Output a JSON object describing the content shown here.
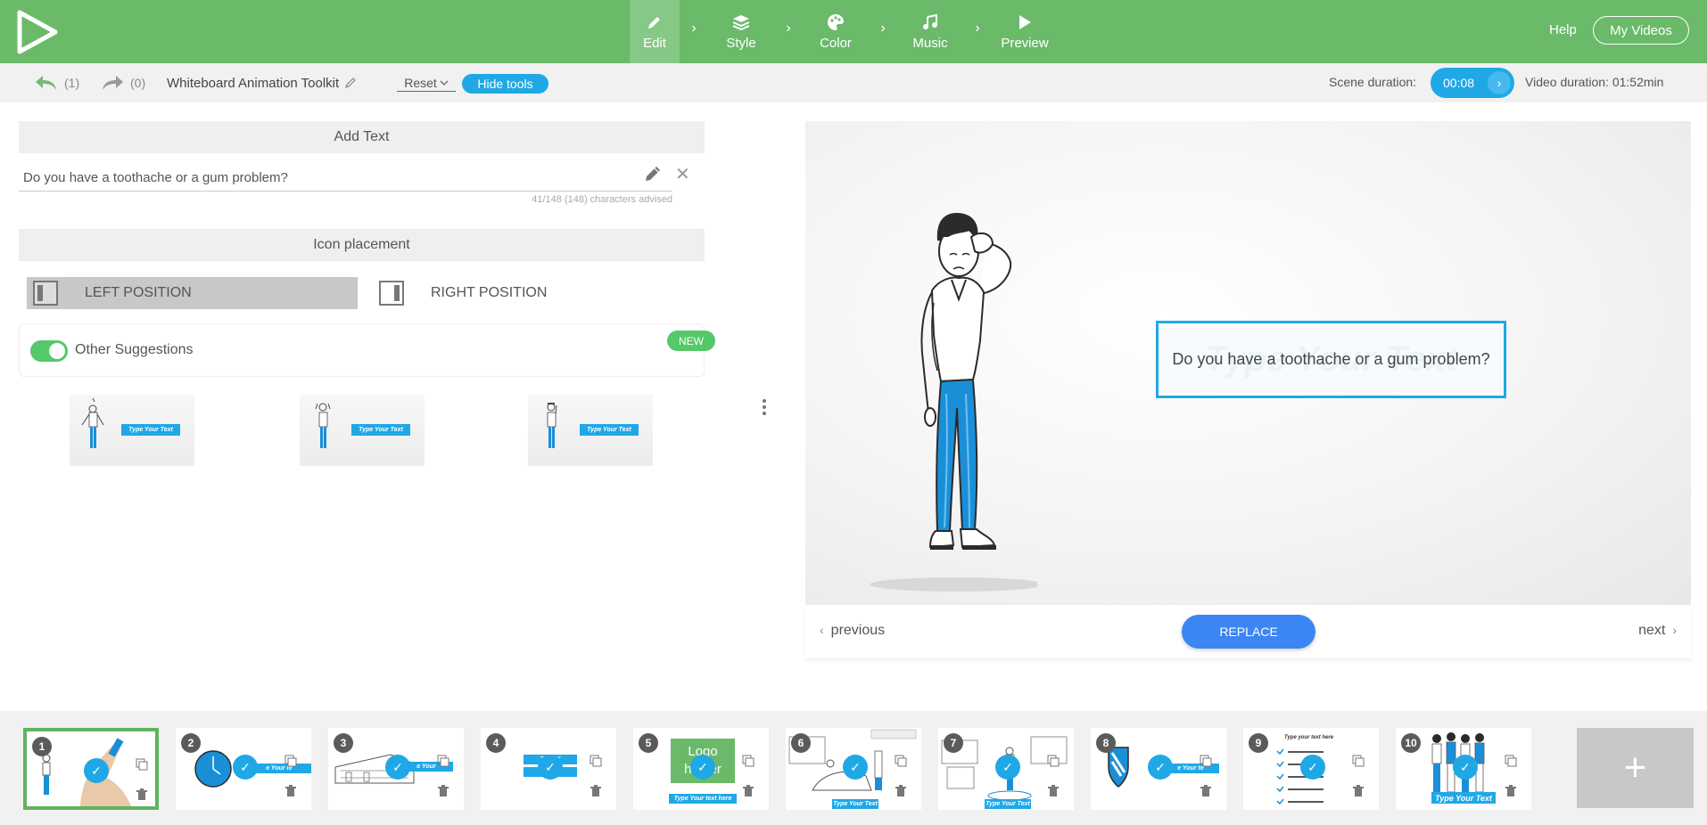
{
  "topbar": {
    "steps": [
      {
        "label": "Edit",
        "icon": "pencil-icon"
      },
      {
        "label": "Style",
        "icon": "layers-icon"
      },
      {
        "label": "Color",
        "icon": "palette-icon"
      },
      {
        "label": "Music",
        "icon": "music-icon"
      },
      {
        "label": "Preview",
        "icon": "play-icon"
      }
    ],
    "active_step": "Edit",
    "help": "Help",
    "my_videos": "My Videos"
  },
  "toolbar": {
    "undo_count": "(1)",
    "redo_count": "(0)",
    "project_title": "Whiteboard Animation Toolkit",
    "reset": "Reset",
    "hide_tools": "Hide tools",
    "scene_duration_label": "Scene duration:",
    "scene_duration": "00:08",
    "video_duration": "Video duration: 01:52min"
  },
  "left": {
    "add_text_title": "Add Text",
    "text_value": "Do you have a toothache or a gum problem?",
    "char_count": "41/148 (148) characters advised",
    "icon_placement_title": "Icon placement",
    "left_position": "LEFT POSITION",
    "right_position": "RIGHT POSITION",
    "other_suggestions": "Other Suggestions",
    "new_badge": "NEW",
    "suggestion_label": "Type Your Text"
  },
  "preview": {
    "ghost_text": "Type Your Text",
    "scene_text": "Do you have a toothache or a gum problem?",
    "previous": "previous",
    "next": "next",
    "replace": "REPLACE"
  },
  "scenes": [
    {
      "num": "1",
      "caption": ""
    },
    {
      "num": "2",
      "caption": "e Your te"
    },
    {
      "num": "3",
      "caption": "e Your"
    },
    {
      "num": "4",
      "caption": "Type Y"
    },
    {
      "num": "5",
      "caption": "Type Your text here",
      "logo": "Logo holder"
    },
    {
      "num": "6",
      "caption": "Type Your Text"
    },
    {
      "num": "7",
      "caption": "Type Your Text"
    },
    {
      "num": "8",
      "caption": "e Your te"
    },
    {
      "num": "9",
      "caption": "Type your text here"
    },
    {
      "num": "10",
      "caption": "Type Your Text"
    }
  ],
  "add_scene": "+",
  "colors": {
    "brand_green": "#6aba6a",
    "accent_blue": "#20a8e6",
    "replace_blue": "#3b86f2"
  }
}
